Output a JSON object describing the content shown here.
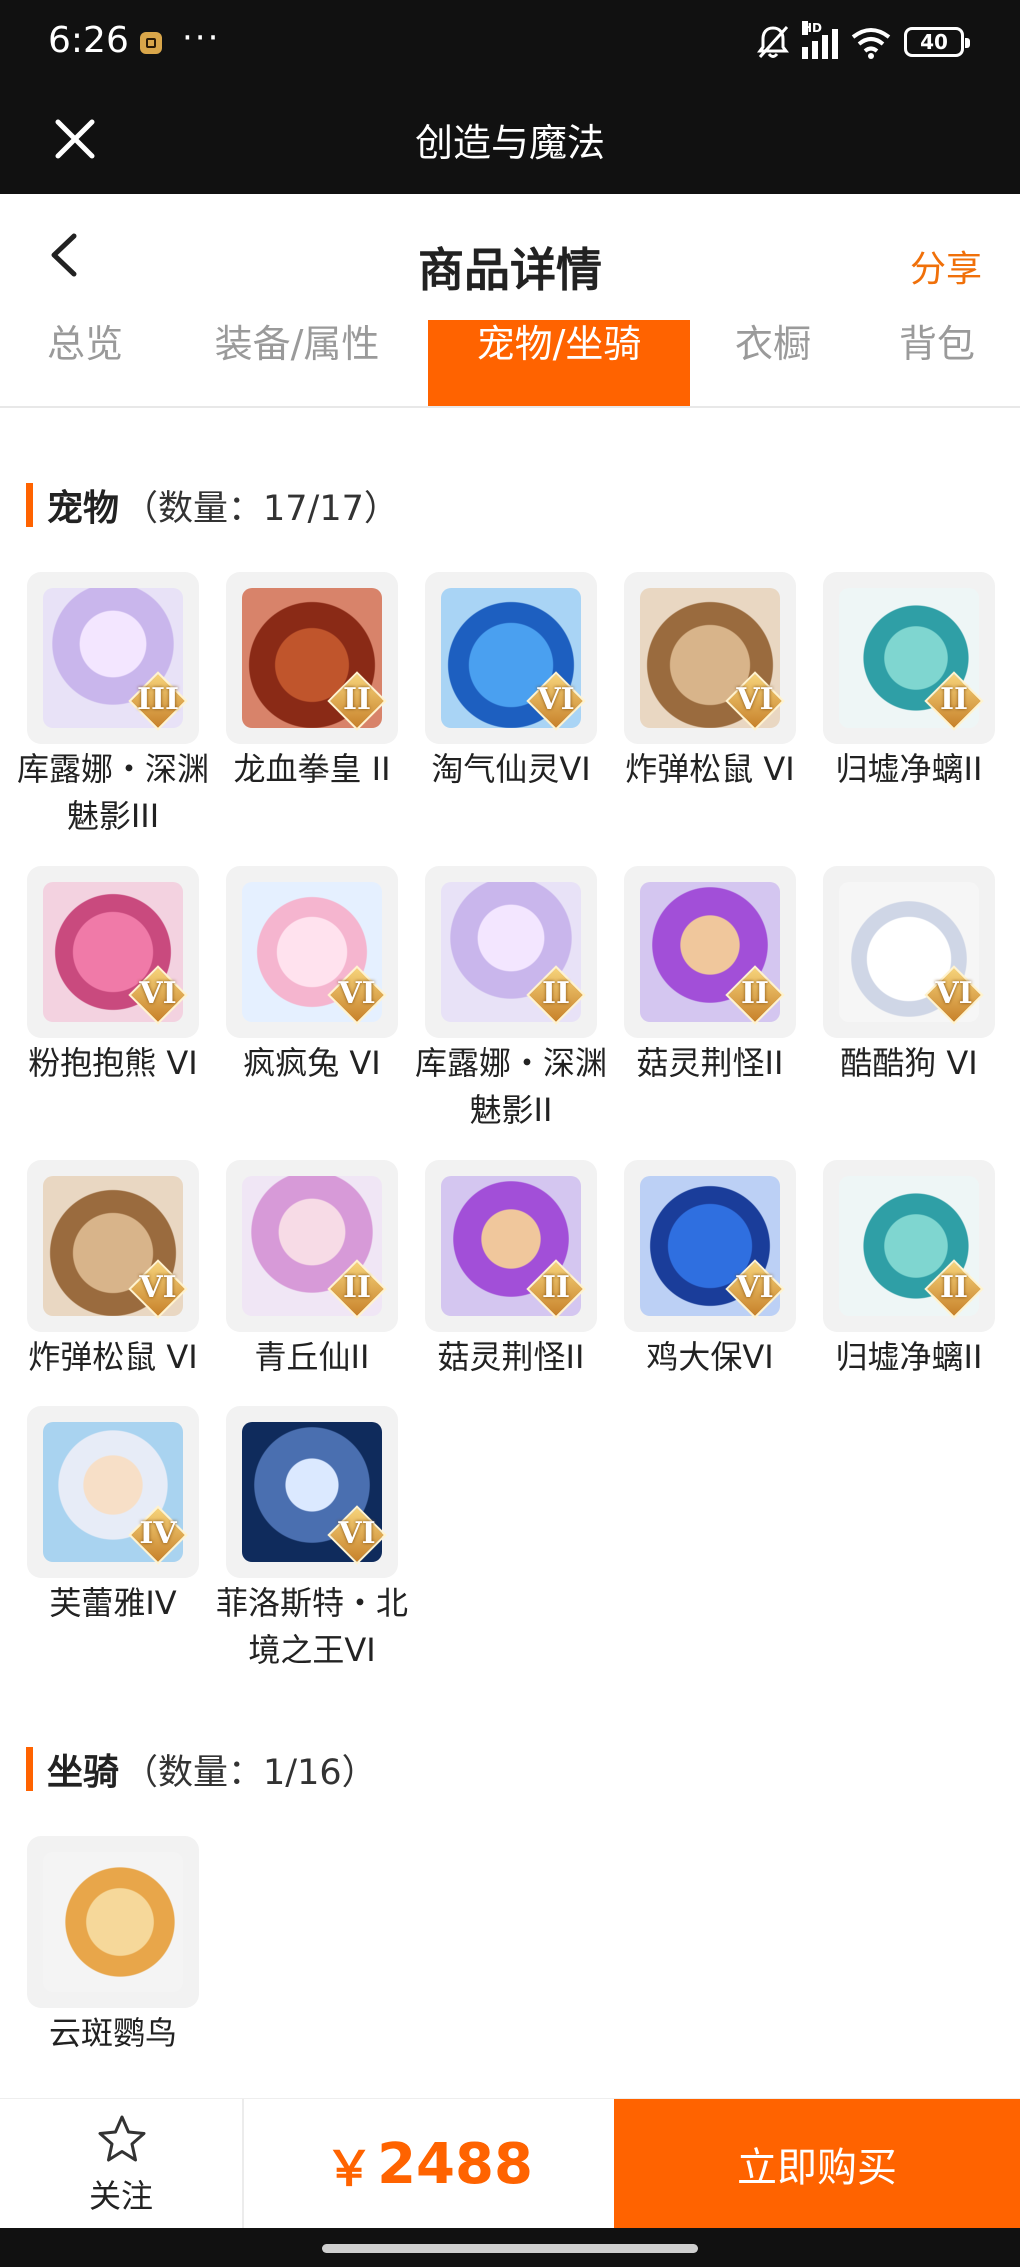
{
  "status_bar": {
    "time": "6:26",
    "more": "···",
    "battery": "40"
  },
  "webview": {
    "title": "创造与魔法"
  },
  "header": {
    "title": "商品详情",
    "share": "分享"
  },
  "tabs": [
    {
      "label": "总览",
      "active": false
    },
    {
      "label": "装备/属性",
      "active": false
    },
    {
      "label": "宠物/坐骑",
      "active": true
    },
    {
      "label": "衣橱",
      "active": false
    },
    {
      "label": "背包",
      "active": false
    }
  ],
  "pets": {
    "title": "宠物",
    "count": "（数量：17/17）",
    "items": [
      {
        "name": "库露娜・深渊魅影III",
        "grade": "III"
      },
      {
        "name": "龙血拳皇 II",
        "grade": "II"
      },
      {
        "name": "淘气仙灵VI",
        "grade": "VI"
      },
      {
        "name": "炸弹松鼠 VI",
        "grade": "VI"
      },
      {
        "name": "归墟净螭II",
        "grade": "II"
      },
      {
        "name": "粉抱抱熊 VI",
        "grade": "VI"
      },
      {
        "name": "疯疯兔 VI",
        "grade": "VI"
      },
      {
        "name": "库露娜・深渊魅影II",
        "grade": "II"
      },
      {
        "name": "菇灵荆怪II",
        "grade": "II"
      },
      {
        "name": "酷酷狗 VI",
        "grade": "VI"
      },
      {
        "name": "炸弹松鼠 VI",
        "grade": "VI"
      },
      {
        "name": "青丘仙II",
        "grade": "II"
      },
      {
        "name": "菇灵荆怪II",
        "grade": "II"
      },
      {
        "name": "鸡大保VI",
        "grade": "VI"
      },
      {
        "name": "归墟净螭II",
        "grade": "II"
      },
      {
        "name": "芙蕾雅IV",
        "grade": "IV"
      },
      {
        "name": "菲洛斯特・北境之王VI",
        "grade": "VI"
      }
    ]
  },
  "mounts": {
    "title": "坐骑",
    "count": "（数量：1/16）",
    "items": [
      {
        "name": "云斑鹦鸟"
      }
    ]
  },
  "bottom": {
    "follow": "关注",
    "currency": "￥",
    "price": "2488",
    "buy": "立即购买"
  },
  "colors": {
    "accent": "#ff6300",
    "share": "#f0700a",
    "topbar": "#111111"
  }
}
